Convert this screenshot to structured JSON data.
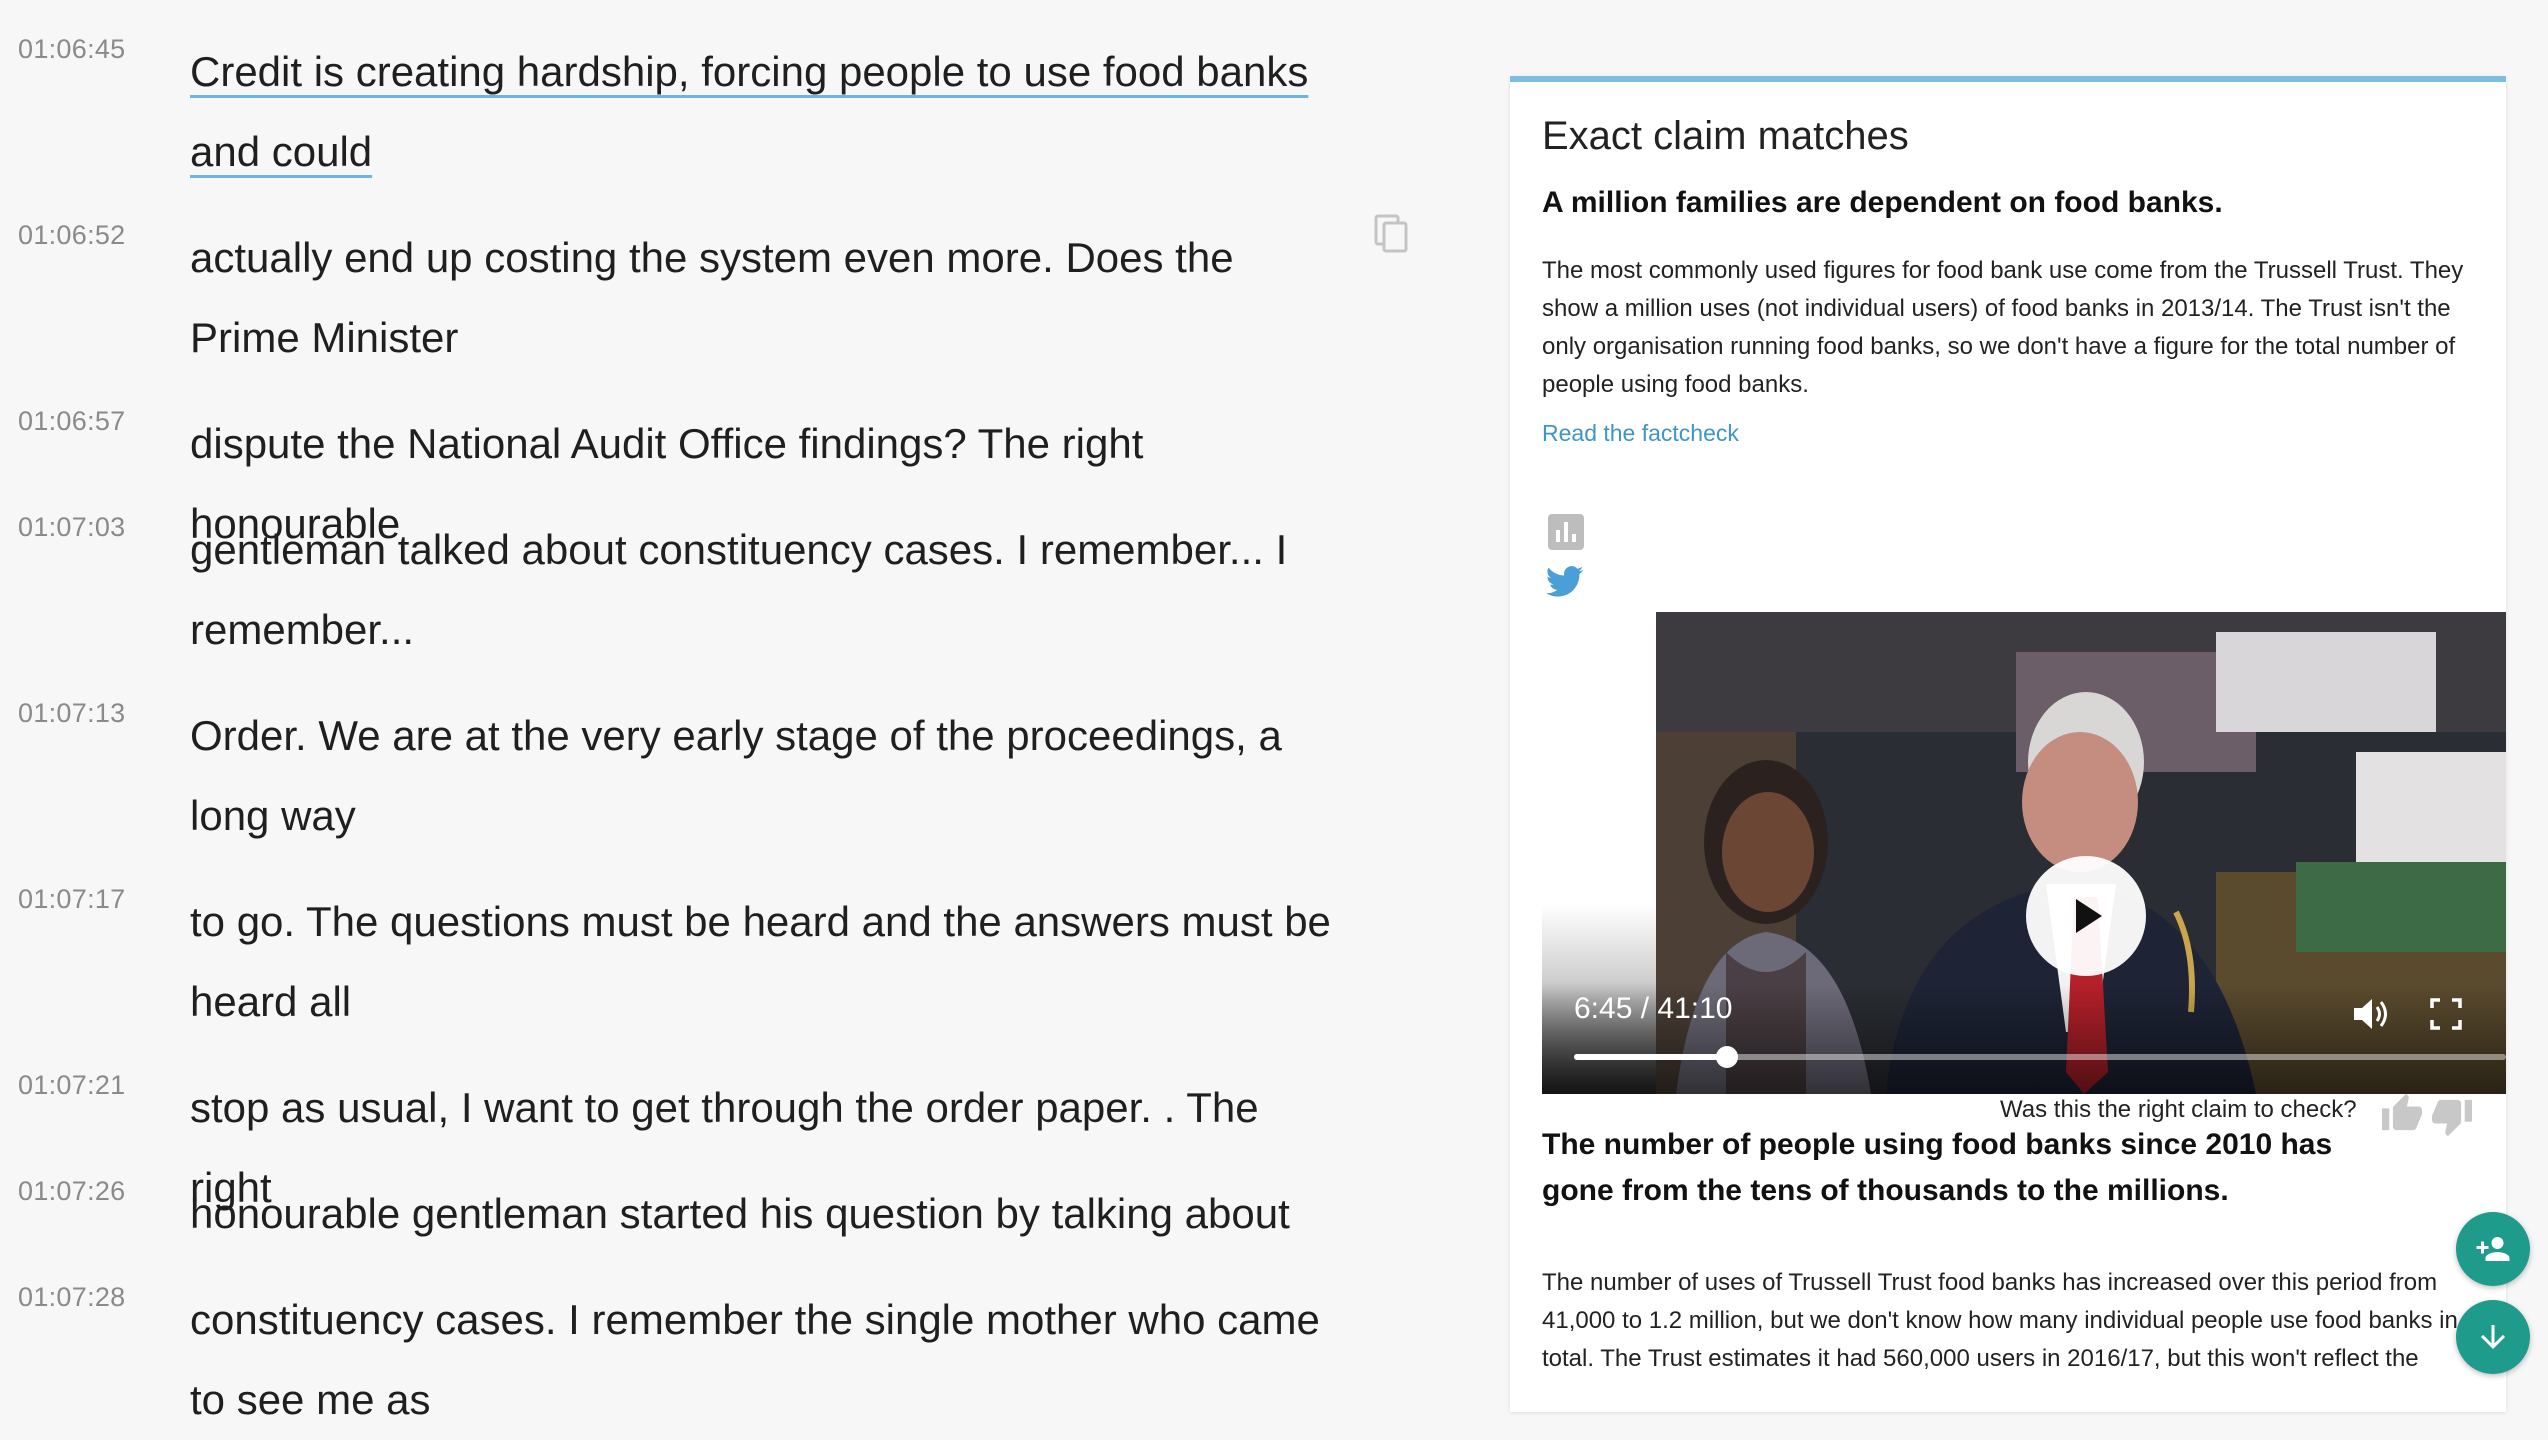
{
  "transcript": {
    "rows": [
      {
        "time": "01:06:45",
        "text": "Credit is creating hardship, forcing people to use food banks and could"
      },
      {
        "time": "01:06:52",
        "text": "actually end up costing the system even more. Does the Prime Minister"
      },
      {
        "time": "01:06:57",
        "text": "dispute the National Audit Office findings? The right honourable"
      },
      {
        "time": "01:07:03",
        "text": "gentleman talked about constituency cases. I remember... I remember..."
      },
      {
        "time": "01:07:13",
        "text": "Order. We are at the very early stage of the proceedings, a long way"
      },
      {
        "time": "01:07:17",
        "text": "to go. The questions must be heard and the answers must be heard all"
      },
      {
        "time": "01:07:21",
        "text": "stop as usual, I want to get through the order paper. . The right"
      },
      {
        "time": "01:07:26",
        "text": "honourable gentleman started his question by talking about"
      },
      {
        "time": "01:07:28",
        "text": "constituency cases. I remember the single mother who came to see me as"
      }
    ]
  },
  "panel": {
    "heading": "Exact claim matches",
    "claim1": {
      "title": "A million families are dependent on food banks.",
      "body": "The most commonly used figures for food bank use come from the Trussell Trust. They show a million uses (not individual users) of food banks in 2013/14. The Trust isn't the only organisation running food banks, so we don't have a figure for the total number of people using food banks.",
      "link": "Read the factcheck"
    },
    "video": {
      "time": "6:45 / 41:10",
      "progress": 0.164
    },
    "feedback_question": "Was this the right claim to check?",
    "claim2": {
      "title": "The number of people using food banks since 2010 has gone from the tens of thousands to the millions.",
      "body": "The number of uses of Trussell Trust food banks has increased over this period from 41,000 to 1.2 million, but we don't know how many individual people use food banks in total. The Trust estimates it had 560,000 users in 2016/17, but this won't reflect the"
    }
  },
  "icons": [
    "copy-icon",
    "stats-icon",
    "twitter-icon",
    "play-icon",
    "volume-icon",
    "fullscreen-icon",
    "thumb-up-icon",
    "thumb-down-icon",
    "add-person-icon",
    "arrow-down-icon"
  ],
  "colors": {
    "accent": "#7fbde3",
    "link": "#3d95c9",
    "fab": "#1e9b8a",
    "underline": "#6fb4dc"
  }
}
